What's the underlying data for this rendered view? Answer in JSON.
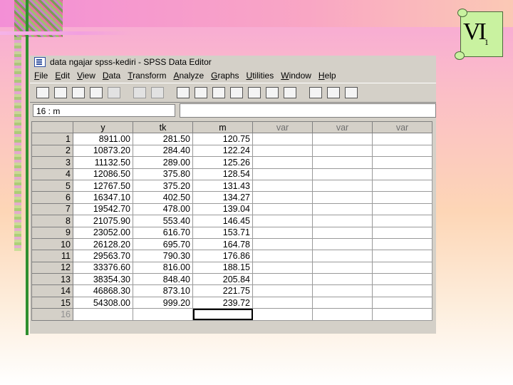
{
  "slide": {
    "badge_text": "VI",
    "badge_sub": "1"
  },
  "window": {
    "title": "data ngajar spss-kediri - SPSS Data Editor",
    "menu": [
      {
        "pre": "",
        "u": "F",
        "post": "ile"
      },
      {
        "pre": "",
        "u": "E",
        "post": "dit"
      },
      {
        "pre": "",
        "u": "V",
        "post": "iew"
      },
      {
        "pre": "",
        "u": "D",
        "post": "ata"
      },
      {
        "pre": "",
        "u": "T",
        "post": "ransform"
      },
      {
        "pre": "",
        "u": "A",
        "post": "nalyze"
      },
      {
        "pre": "",
        "u": "G",
        "post": "raphs"
      },
      {
        "pre": "",
        "u": "U",
        "post": "tilities"
      },
      {
        "pre": "",
        "u": "W",
        "post": "indow"
      },
      {
        "pre": "",
        "u": "H",
        "post": "elp"
      }
    ],
    "cell_ref": "16 : m",
    "cell_value": ""
  },
  "grid": {
    "columns": [
      "y",
      "tk",
      "m",
      "var",
      "var",
      "var"
    ],
    "rows": [
      [
        "1",
        "8911.00",
        "281.50",
        "120.75"
      ],
      [
        "2",
        "10873.20",
        "284.40",
        "122.24"
      ],
      [
        "3",
        "11132.50",
        "289.00",
        "125.26"
      ],
      [
        "4",
        "12086.50",
        "375.80",
        "128.54"
      ],
      [
        "5",
        "12767.50",
        "375.20",
        "131.43"
      ],
      [
        "6",
        "16347.10",
        "402.50",
        "134.27"
      ],
      [
        "7",
        "19542.70",
        "478.00",
        "139.04"
      ],
      [
        "8",
        "21075.90",
        "553.40",
        "146.45"
      ],
      [
        "9",
        "23052.00",
        "616.70",
        "153.71"
      ],
      [
        "10",
        "26128.20",
        "695.70",
        "164.78"
      ],
      [
        "11",
        "29563.70",
        "790.30",
        "176.86"
      ],
      [
        "12",
        "33376.60",
        "816.00",
        "188.15"
      ],
      [
        "13",
        "38354.30",
        "848.40",
        "205.84"
      ],
      [
        "14",
        "46868.30",
        "873.10",
        "221.75"
      ],
      [
        "15",
        "54308.00",
        "999.20",
        "239.72"
      ],
      [
        "16",
        "",
        "",
        ""
      ]
    ]
  },
  "toolbar_icons": [
    "open-icon",
    "save-icon",
    "print-icon",
    "dialog-recall-icon",
    "undo-icon",
    "redo-icon",
    "goto-chart-icon",
    "goto-case-icon",
    "variables-icon",
    "find-icon",
    "insert-case-icon",
    "insert-variable-icon",
    "split-file-icon",
    "weight-cases-icon",
    "select-cases-icon",
    "value-labels-icon",
    "use-sets-icon"
  ]
}
